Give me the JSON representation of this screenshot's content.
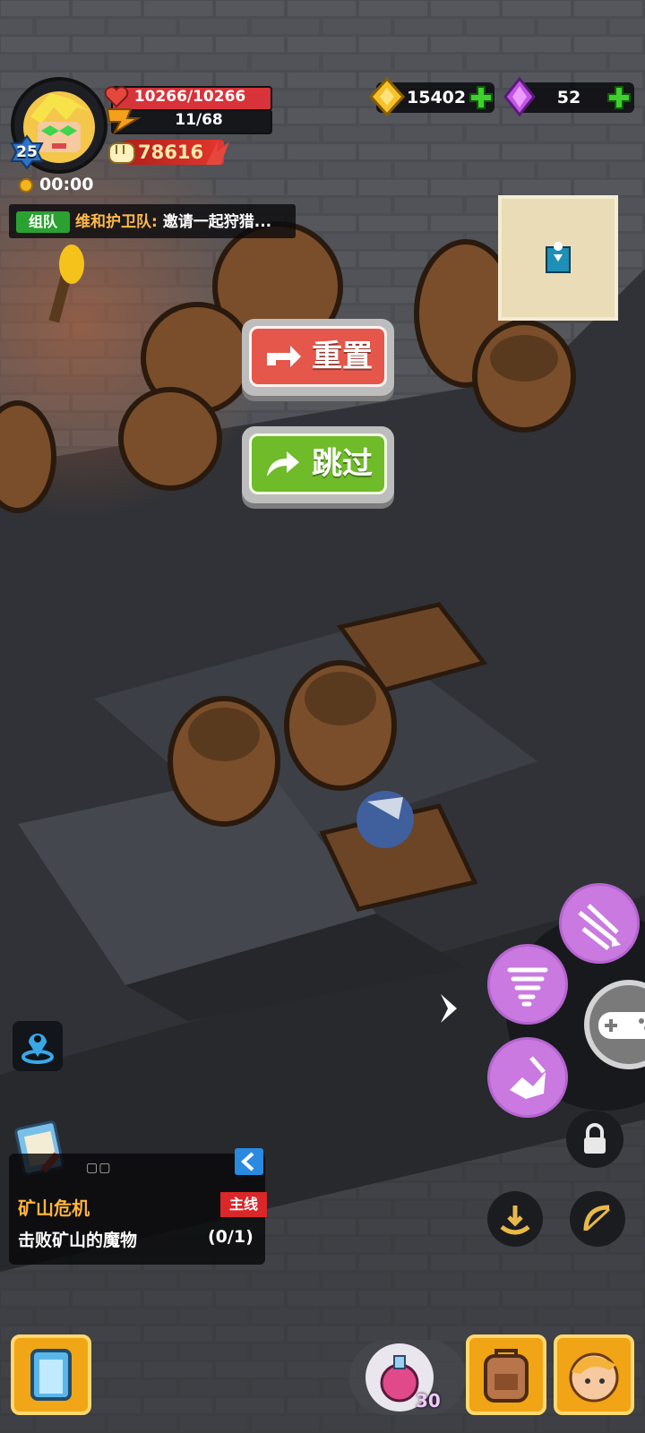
{
  "hud": {
    "level": "25",
    "hp": "10266/10266",
    "energy": "11/68",
    "power": "78616",
    "timer": "00:00"
  },
  "currency": {
    "gold": "15402",
    "gems": "52"
  },
  "team": {
    "tag": "组队",
    "team_name": "维和护卫队:",
    "message": "邀请一起狩猎..."
  },
  "buttons": {
    "reset_label": "重置",
    "skip_label": "跳过"
  },
  "quest": {
    "indicator": "▢▢",
    "title": "矿山危机",
    "tag": "主线",
    "description": "击败矿山的魔物",
    "progress": "(0/1)"
  },
  "items": {
    "potion_count": "30"
  }
}
